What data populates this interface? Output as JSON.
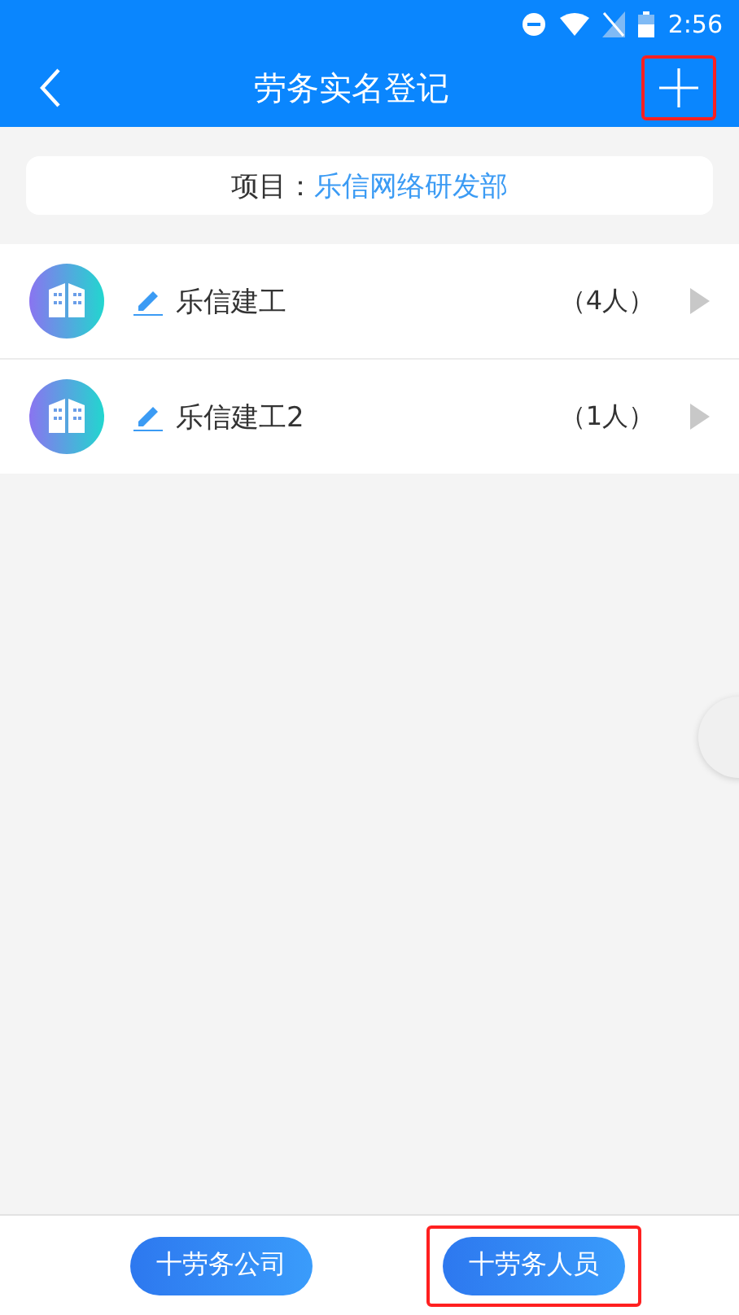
{
  "status_bar": {
    "time": "2:56"
  },
  "header": {
    "title": "劳务实名登记",
    "add_button": {
      "highlighted": true
    }
  },
  "project": {
    "label": "项目：",
    "value": "乐信网络研发部"
  },
  "companies": [
    {
      "name": "乐信建工",
      "count": "（4人）"
    },
    {
      "name": "乐信建工2",
      "count": "（1人）"
    }
  ],
  "bottom_buttons": [
    {
      "label": "十劳务公司",
      "highlighted": false
    },
    {
      "label": "十劳务人员",
      "highlighted": true
    }
  ]
}
